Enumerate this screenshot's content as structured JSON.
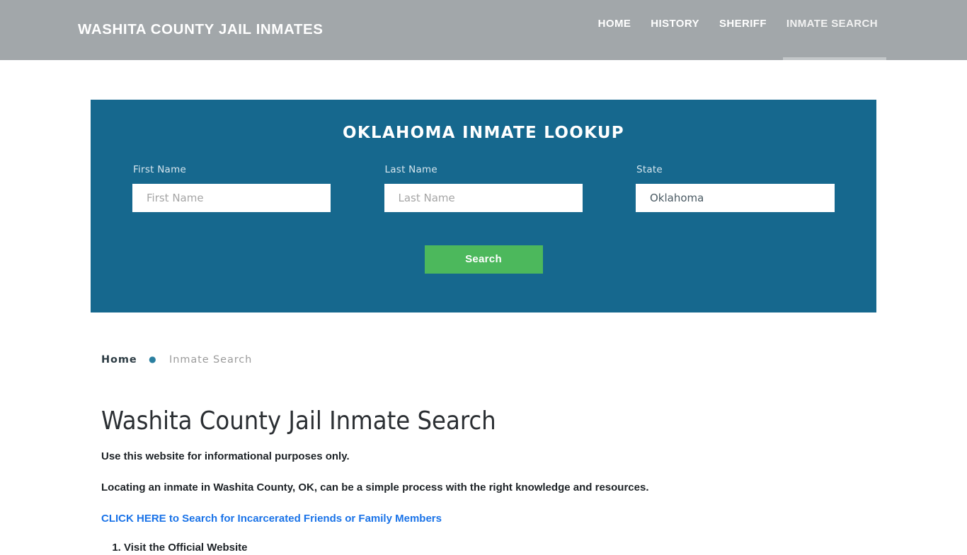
{
  "header": {
    "brand": "WASHITA COUNTY JAIL INMATES",
    "nav": [
      {
        "label": "HOME",
        "active": false
      },
      {
        "label": "HISTORY",
        "active": false
      },
      {
        "label": "SHERIFF",
        "active": false
      },
      {
        "label": "INMATE SEARCH",
        "active": true
      }
    ]
  },
  "search_panel": {
    "title": "OKLAHOMA INMATE LOOKUP",
    "first_name": {
      "label": "First Name",
      "placeholder": "First Name",
      "value": ""
    },
    "last_name": {
      "label": "Last Name",
      "placeholder": "Last Name",
      "value": ""
    },
    "state": {
      "label": "State",
      "value": "Oklahoma"
    },
    "submit_label": "Search",
    "colors": {
      "panel_bg": "#16688e",
      "button_bg": "#4cb85c",
      "header_bg": "#a2a7aa"
    }
  },
  "breadcrumb": {
    "home": "Home",
    "separator": "●",
    "current": "Inmate Search"
  },
  "main": {
    "title": "Washita County Jail Inmate Search",
    "paragraph_1": "Use this website for informational purposes only.",
    "paragraph_2": "Locating an inmate in Washita County, OK, can be a simple process with the right knowledge and resources.",
    "cta_link": "CLICK HERE to Search for Incarcerated Friends or Family Members",
    "steps": [
      "Visit the Official Website"
    ]
  }
}
